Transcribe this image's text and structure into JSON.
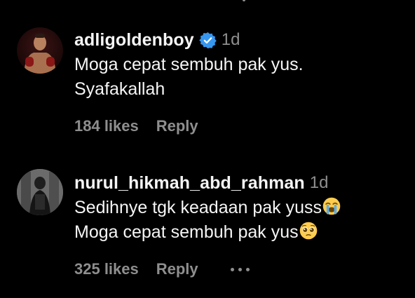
{
  "comments": [
    {
      "username": "adligoldenboy",
      "verified": true,
      "time": "1d",
      "lines": [
        "Moga cepat sembuh pak yus.",
        "Syafakallah"
      ],
      "likes": "184 likes",
      "reply": "Reply"
    },
    {
      "username": "nurul_hikmah_abd_rahman",
      "verified": false,
      "time": "1d",
      "lines": [
        "Sedihnye tgk keadaan pak yuss",
        "Moga cepat sembuh pak yus"
      ],
      "emojis": [
        "loudly-crying-face",
        "pleading-face"
      ],
      "likes": "325 likes",
      "reply": "Reply"
    }
  ],
  "colors": {
    "background": "#000000",
    "primary_text": "#f5f5f5",
    "secondary_text": "#8e8e8e",
    "verified_badge": "#3797f0"
  }
}
